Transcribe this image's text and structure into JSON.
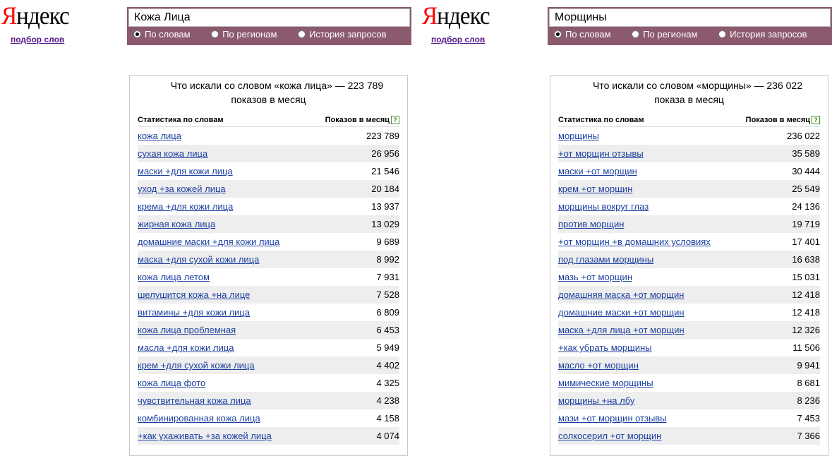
{
  "left": {
    "logo_first": "Я",
    "logo_rest": "ндекс",
    "wordstat_link": "подбор слов",
    "query": "Кожа Лица",
    "radios": [
      "По словам",
      "По регионам",
      "История запросов"
    ],
    "heading_line1": "Что искали со словом «кожа лица» — 223 789",
    "heading_line2": "показов в месяц",
    "col_words": "Статистика по словам",
    "col_shows": "Показов в месяц",
    "help_icon": "?",
    "rows": [
      {
        "q": "кожа лица",
        "n": "223 789"
      },
      {
        "q": "сухая кожа лица",
        "n": "26 956"
      },
      {
        "q": "маски +для кожи лица",
        "n": "21 546"
      },
      {
        "q": "уход +за кожей лица",
        "n": "20 184"
      },
      {
        "q": "крема +для кожи лица",
        "n": "13 937"
      },
      {
        "q": "жирная кожа лица",
        "n": "13 029"
      },
      {
        "q": "домашние маски +для кожи лица",
        "n": "9 689"
      },
      {
        "q": "маска +для сухой кожи лица",
        "n": "8 992"
      },
      {
        "q": "кожа лица летом",
        "n": "7 931"
      },
      {
        "q": "шелушится кожа +на лице",
        "n": "7 528"
      },
      {
        "q": "витамины +для кожи лица",
        "n": "6 809"
      },
      {
        "q": "кожа лица проблемная",
        "n": "6 453"
      },
      {
        "q": "масла +для кожи лица",
        "n": "5 949"
      },
      {
        "q": "крем +для сухой кожи лица",
        "n": "4 402"
      },
      {
        "q": "кожа лица фото",
        "n": "4 325"
      },
      {
        "q": "чувствительная кожа лица",
        "n": "4 238"
      },
      {
        "q": "комбинированная кожа лица",
        "n": "4 158"
      },
      {
        "q": "+как ухаживать +за кожей лица",
        "n": "4 074"
      }
    ]
  },
  "right": {
    "logo_first": "Я",
    "logo_rest": "ндекс",
    "wordstat_link": "подбор слов",
    "query": "Морщины",
    "radios": [
      "По словам",
      "По регионам",
      "История запросов"
    ],
    "heading_line1": "Что искали со словом «морщины» — 236 022",
    "heading_line2": "показа в месяц",
    "col_words": "Статистика по словам",
    "col_shows": "Показов в месяц",
    "help_icon": "?",
    "rows": [
      {
        "q": "морщины",
        "n": "236 022"
      },
      {
        "q": "+от морщин отзывы",
        "n": "35 589"
      },
      {
        "q": "маски +от морщин",
        "n": "30 444"
      },
      {
        "q": "крем +от морщин",
        "n": "25 549"
      },
      {
        "q": "морщины вокруг глаз",
        "n": "24 136"
      },
      {
        "q": "против морщин",
        "n": "19 719"
      },
      {
        "q": "+от морщин +в домашних условиях",
        "n": "17 401"
      },
      {
        "q": "под глазами морщины",
        "n": "16 638"
      },
      {
        "q": "мазь +от морщин",
        "n": "15 031"
      },
      {
        "q": "домашняя маска +от морщин",
        "n": "12 418"
      },
      {
        "q": "домашние маски +от морщин",
        "n": "12 418"
      },
      {
        "q": "маска +для лица +от морщин",
        "n": "12 326"
      },
      {
        "q": "+как убрать морщины",
        "n": "11 506"
      },
      {
        "q": "масло +от морщин",
        "n": "9 941"
      },
      {
        "q": "мимические морщины",
        "n": "8 681"
      },
      {
        "q": "морщины +на лбу",
        "n": "8 236"
      },
      {
        "q": "мази +от морщин отзывы",
        "n": "7 453"
      },
      {
        "q": "солкосерил +от морщин",
        "n": "7 366"
      }
    ]
  },
  "colors": {
    "bar": "#8c5a6e",
    "link": "#1c3fa0",
    "logo_red": "#ff0000",
    "visited": "#551a8b"
  }
}
